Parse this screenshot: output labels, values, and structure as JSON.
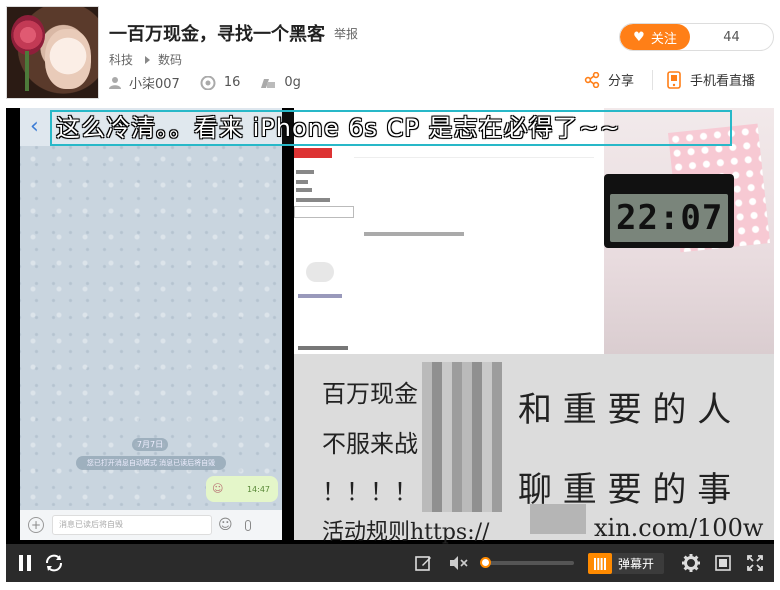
{
  "stream": {
    "title": "一百万现金，寻找一个黑客",
    "report_label": "举报",
    "category": "科技",
    "subcategory": "数码",
    "host": "小柒007",
    "viewers": "16",
    "gifts": "0g"
  },
  "follow": {
    "label": "关注",
    "count": "44"
  },
  "actions": {
    "share": "分享",
    "mobile": "手机看直播"
  },
  "video": {
    "danmaku_text": "这么冷清。。看来 iPhone 6s  CP 是志在必得了~~",
    "chat": {
      "day": "7月7日",
      "system": "您已打开消息自动模式 消息已读后将自毁",
      "bubble_time": "14:47",
      "input_placeholder": "消息已读后将自毁"
    },
    "clock_reading": "22:07",
    "promo": {
      "line1": "百万现金",
      "line2": "不服来战",
      "line3": "！！！！",
      "line4": "活动规则https://",
      "right1": "和 重 要 的 人",
      "right2": "聊 重 要 的 事",
      "url_tail": "xin.com/100w"
    }
  },
  "player": {
    "danmaku_toggle_label": "弹幕开",
    "volume_level": 0.0,
    "accent": "#ff8a00"
  }
}
